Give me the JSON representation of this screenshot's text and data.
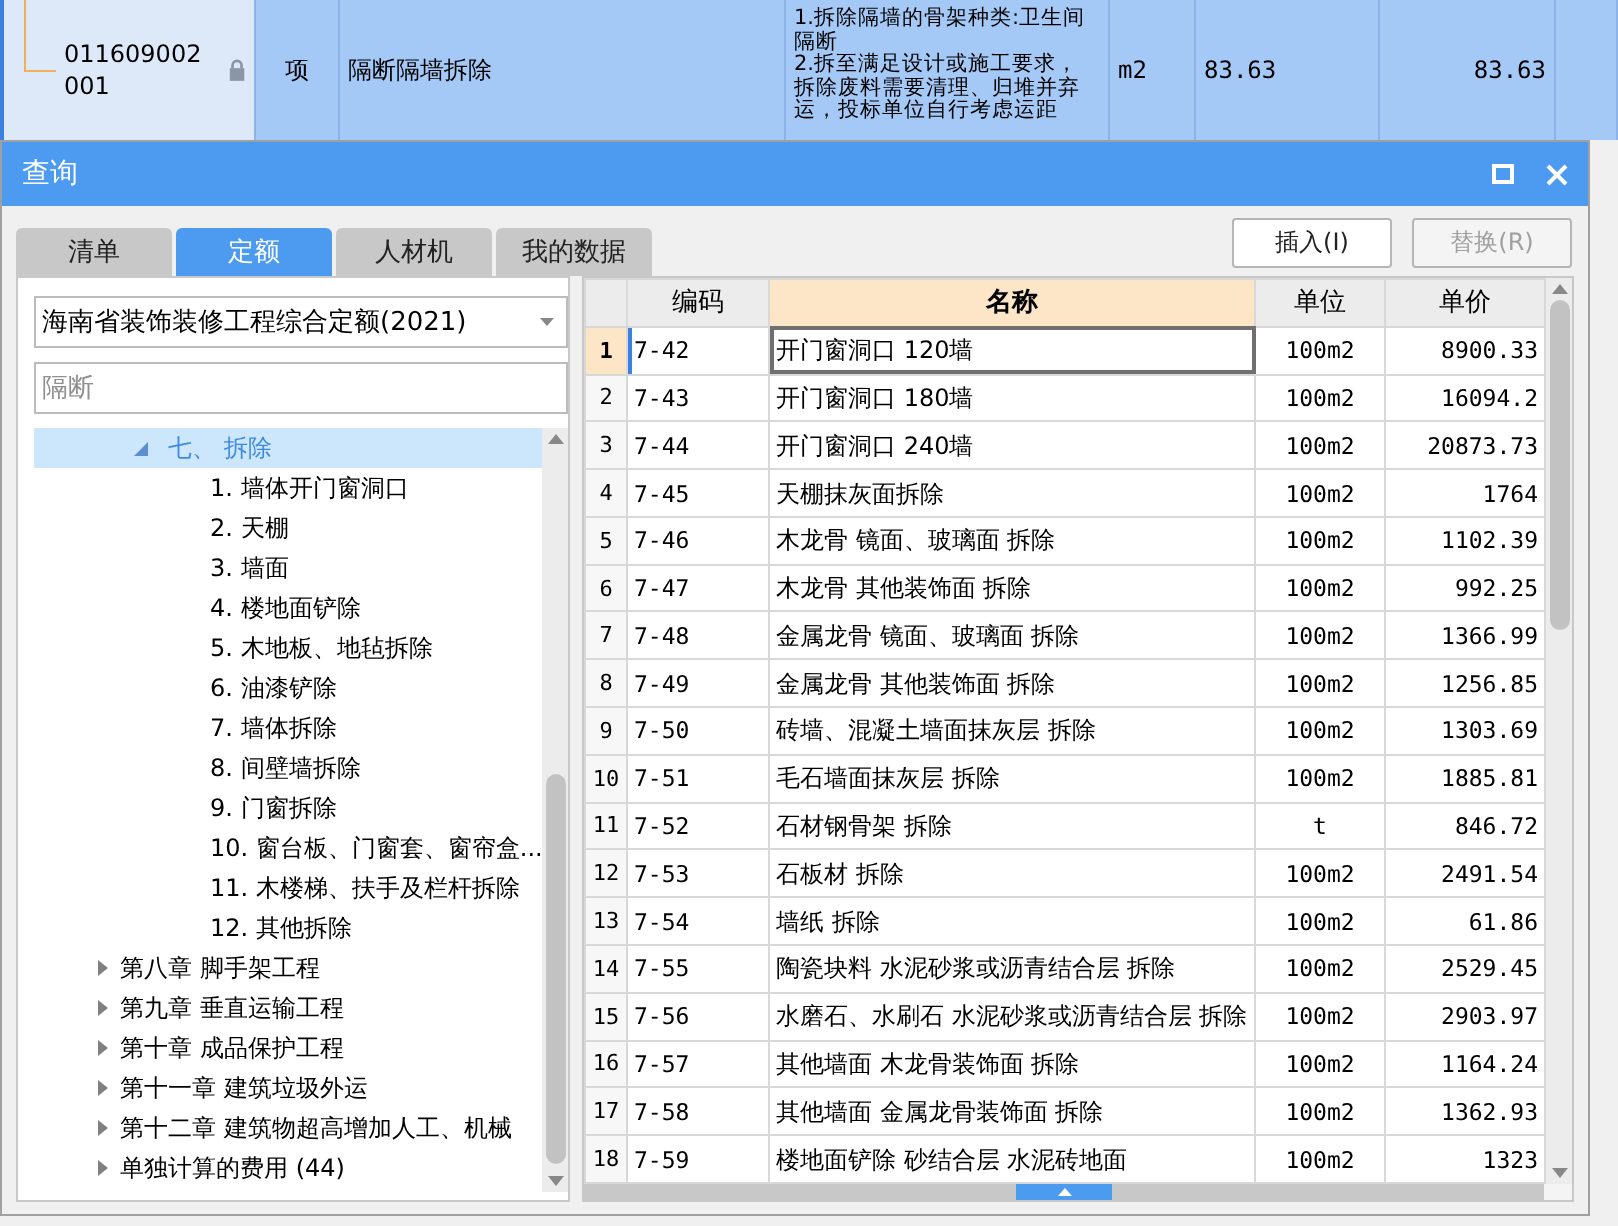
{
  "background_row": {
    "code": "011609002001",
    "locked": true,
    "type": "项",
    "name": "隔断隔墙拆除",
    "description": [
      "1.拆除隔墙的骨架种类:卫生间隔断",
      "2.拆至满足设计或施工要求，拆除废料需要清理、归堆并弃运，投标单位自行考虑运距"
    ],
    "unit": "m2",
    "quantity": "83.63",
    "price": "83.63"
  },
  "dialog": {
    "title": "查询"
  },
  "tabs": [
    {
      "label": "清单",
      "selected": false
    },
    {
      "label": "定额",
      "selected": true
    },
    {
      "label": "人材机",
      "selected": false
    },
    {
      "label": "我的数据",
      "selected": false
    }
  ],
  "buttons": [
    {
      "label": "插入(I)",
      "disabled": false
    },
    {
      "label": "替换(R)",
      "disabled": true
    }
  ],
  "quota_dropdown": {
    "value": "海南省装饰装修工程综合定额(2021)"
  },
  "search": {
    "placeholder": "隔断"
  },
  "tree": [
    {
      "kind": "section",
      "label": "七、 拆除",
      "expanded": true,
      "selected": true,
      "children": [
        {
          "label": "1. 墙体开门窗洞口"
        },
        {
          "label": "2. 天棚"
        },
        {
          "label": "3. 墙面"
        },
        {
          "label": "4. 楼地面铲除"
        },
        {
          "label": "5. 木地板、地毡拆除"
        },
        {
          "label": "6. 油漆铲除"
        },
        {
          "label": "7. 墙体拆除"
        },
        {
          "label": "8. 间壁墙拆除"
        },
        {
          "label": "9. 门窗拆除"
        },
        {
          "label": "10. 窗台板、门窗套、窗帘盒..."
        },
        {
          "label": "11. 木楼梯、扶手及栏杆拆除"
        },
        {
          "label": "12. 其他拆除"
        }
      ]
    },
    {
      "kind": "chapter",
      "label": "第八章 脚手架工程",
      "expanded": false,
      "selected": false
    },
    {
      "kind": "chapter",
      "label": "第九章 垂直运输工程",
      "expanded": false,
      "selected": false
    },
    {
      "kind": "chapter",
      "label": "第十章 成品保护工程",
      "expanded": false,
      "selected": false
    },
    {
      "kind": "chapter",
      "label": "第十一章 建筑垃圾外运",
      "expanded": false,
      "selected": false
    },
    {
      "kind": "chapter",
      "label": "第十二章 建筑物超高增加人工、机械",
      "expanded": false,
      "selected": false
    },
    {
      "kind": "chapter",
      "label": "单独计算的费用 (44)",
      "expanded": false,
      "selected": false
    }
  ],
  "table": {
    "columns": [
      "编码",
      "名称",
      "单位",
      "单价"
    ],
    "rows": [
      {
        "index": "1",
        "code": "7-42",
        "name": "开门窗洞口 120墙",
        "unit": "100m2",
        "price": "8900.33",
        "selected": true
      },
      {
        "index": "2",
        "code": "7-43",
        "name": "开门窗洞口 180墙",
        "unit": "100m2",
        "price": "16094.2",
        "selected": false
      },
      {
        "index": "3",
        "code": "7-44",
        "name": "开门窗洞口 240墙",
        "unit": "100m2",
        "price": "20873.73",
        "selected": false
      },
      {
        "index": "4",
        "code": "7-45",
        "name": "天棚抹灰面拆除",
        "unit": "100m2",
        "price": "1764",
        "selected": false
      },
      {
        "index": "5",
        "code": "7-46",
        "name": "木龙骨 镜面、玻璃面 拆除",
        "unit": "100m2",
        "price": "1102.39",
        "selected": false
      },
      {
        "index": "6",
        "code": "7-47",
        "name": "木龙骨 其他装饰面 拆除",
        "unit": "100m2",
        "price": "992.25",
        "selected": false
      },
      {
        "index": "7",
        "code": "7-48",
        "name": "金属龙骨 镜面、玻璃面 拆除",
        "unit": "100m2",
        "price": "1366.99",
        "selected": false
      },
      {
        "index": "8",
        "code": "7-49",
        "name": "金属龙骨 其他装饰面 拆除",
        "unit": "100m2",
        "price": "1256.85",
        "selected": false
      },
      {
        "index": "9",
        "code": "7-50",
        "name": "砖墙、混凝土墙面抹灰层 拆除",
        "unit": "100m2",
        "price": "1303.69",
        "selected": false
      },
      {
        "index": "10",
        "code": "7-51",
        "name": "毛石墙面抹灰层 拆除",
        "unit": "100m2",
        "price": "1885.81",
        "selected": false
      },
      {
        "index": "11",
        "code": "7-52",
        "name": "石材钢骨架 拆除",
        "unit": "t",
        "price": "846.72",
        "selected": false
      },
      {
        "index": "12",
        "code": "7-53",
        "name": "石板材 拆除",
        "unit": "100m2",
        "price": "2491.54",
        "selected": false
      },
      {
        "index": "13",
        "code": "7-54",
        "name": "墙纸 拆除",
        "unit": "100m2",
        "price": "61.86",
        "selected": false
      },
      {
        "index": "14",
        "code": "7-55",
        "name": "陶瓷块料 水泥砂浆或沥青结合层 拆除",
        "unit": "100m2",
        "price": "2529.45",
        "selected": false
      },
      {
        "index": "15",
        "code": "7-56",
        "name": "水磨石、水刷石 水泥砂浆或沥青结合层 拆除",
        "unit": "100m2",
        "price": "2903.97",
        "selected": false
      },
      {
        "index": "16",
        "code": "7-57",
        "name": "其他墙面 木龙骨装饰面 拆除",
        "unit": "100m2",
        "price": "1164.24",
        "selected": false
      },
      {
        "index": "17",
        "code": "7-58",
        "name": "其他墙面 金属龙骨装饰面 拆除",
        "unit": "100m2",
        "price": "1362.93",
        "selected": false
      },
      {
        "index": "18",
        "code": "7-59",
        "name": "楼地面铲除 砂结合层 水泥砖地面",
        "unit": "100m2",
        "price": "1323",
        "selected": false
      }
    ]
  }
}
